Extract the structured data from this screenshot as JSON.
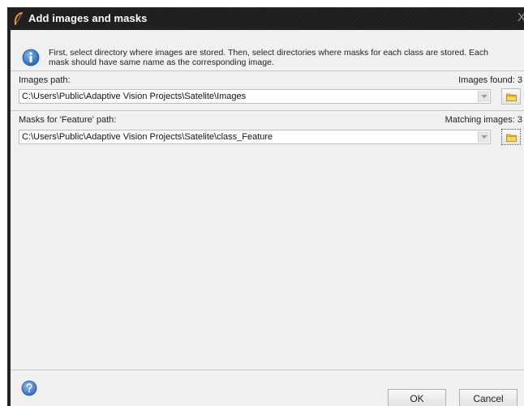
{
  "window": {
    "title": "Add images and masks",
    "close_glyph": "X"
  },
  "info": {
    "icon": "info-icon",
    "line1": "First, select directory where images are stored. Then, select directories where masks for each class are stored. Each",
    "line2": "mask should have same name as the corresponding image."
  },
  "images": {
    "label": "Images path:",
    "found_label": "Images found: 3",
    "path": "C:\\Users\\Public\\Adaptive Vision Projects\\Satelite\\Images",
    "browse_icon": "folder-icon"
  },
  "masks": {
    "label": "Masks for 'Feature' path:",
    "matching_label": "Matching images: 3",
    "path": "C:\\Users\\Public\\Adaptive Vision Projects\\Satelite\\class_Feature",
    "browse_icon": "folder-icon"
  },
  "footer": {
    "help_icon": "help-icon",
    "ok_label": "OK",
    "cancel_label": "Cancel"
  },
  "colors": {
    "titlebar": "#1c1c1c",
    "dialog_bg": "#f0f0f0",
    "info_blue": "#2a74c8",
    "accent_orange": "#e8922c",
    "folder_yellow": "#f2c530"
  }
}
